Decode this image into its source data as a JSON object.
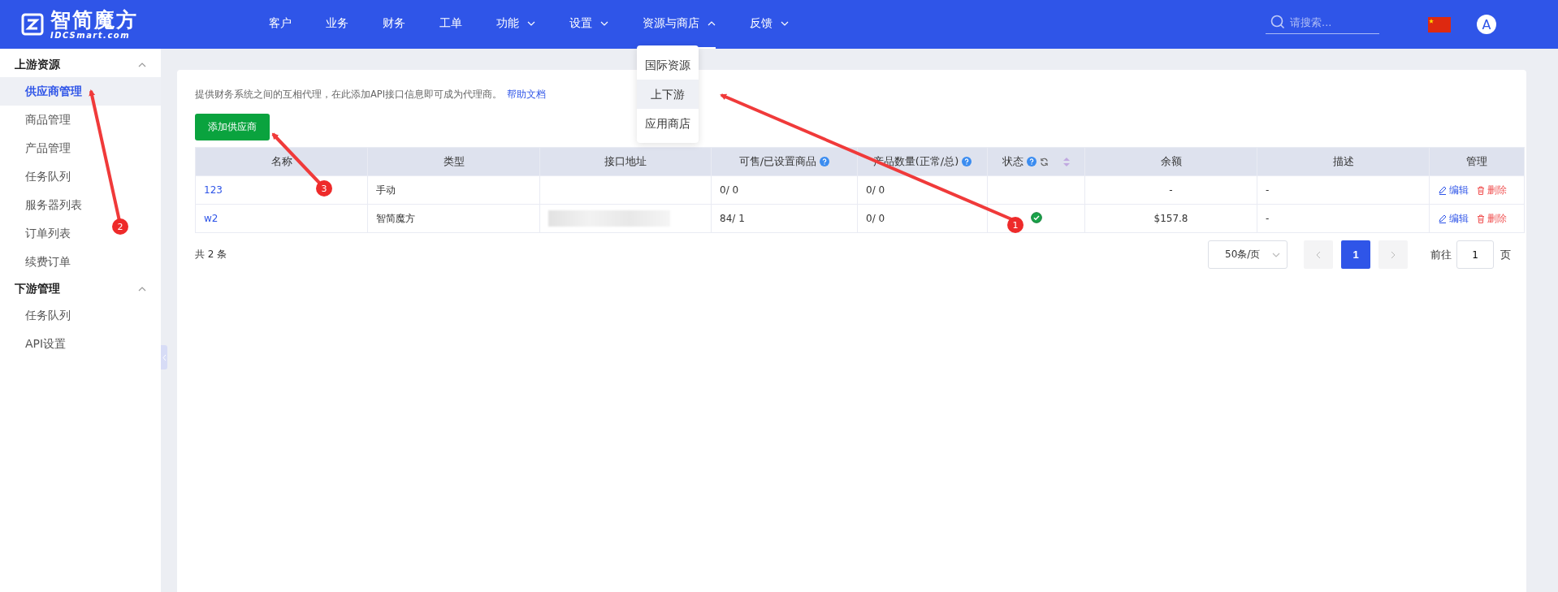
{
  "logo": {
    "name": "智简魔方",
    "domain": "IDCSmart.com"
  },
  "nav": [
    {
      "label": "客户",
      "selected": false
    },
    {
      "label": "业务",
      "selected": false
    },
    {
      "label": "财务",
      "selected": false
    },
    {
      "label": "工单",
      "selected": false
    },
    {
      "label": "功能",
      "selected": false,
      "expanded": false
    },
    {
      "label": "设置",
      "selected": false,
      "expanded": false
    },
    {
      "label": "资源与商店",
      "selected": true,
      "expanded": true,
      "menu": [
        {
          "label": "国际资源",
          "selected": false
        },
        {
          "label": "上下游",
          "selected": true
        },
        {
          "label": "应用商店",
          "selected": false
        }
      ]
    },
    {
      "label": "反馈",
      "selected": false,
      "expanded": false
    }
  ],
  "search": {
    "placeholder": "请搜索..."
  },
  "avatar": "A",
  "sidebar": [
    {
      "title": "上游资源",
      "expanded": true,
      "items": [
        {
          "label": "供应商管理",
          "selected": true
        },
        {
          "label": "商品管理",
          "selected": false
        },
        {
          "label": "产品管理",
          "selected": false
        },
        {
          "label": "任务队列",
          "selected": false
        },
        {
          "label": "服务器列表",
          "selected": false
        },
        {
          "label": "订单列表",
          "selected": false
        },
        {
          "label": "续费订单",
          "selected": false
        }
      ]
    },
    {
      "title": "下游管理",
      "expanded": true,
      "items": [
        {
          "label": "任务队列",
          "selected": false
        },
        {
          "label": "API设置",
          "selected": false
        }
      ]
    }
  ],
  "notice": {
    "text": "提供财务系统之间的互相代理，在此添加API接口信息即可成为代理商。",
    "link": "帮助文档"
  },
  "add_button": "添加供应商",
  "table": {
    "columns": [
      {
        "label": "名称",
        "kind": "plain"
      },
      {
        "label": "类型",
        "kind": "plain"
      },
      {
        "label": "接口地址",
        "kind": "plain"
      },
      {
        "label": "可售/已设置商品",
        "kind": "help"
      },
      {
        "label": "产品数量(正常/总)",
        "kind": "help"
      },
      {
        "label": "状态",
        "kind": "status"
      },
      {
        "label": "余额",
        "kind": "plain"
      },
      {
        "label": "描述",
        "kind": "plain"
      },
      {
        "label": "管理",
        "kind": "plain"
      }
    ],
    "rows": [
      {
        "name": "123",
        "type": "手动",
        "address_blurred": false,
        "goods": "0/ 0",
        "products": "0/ 0",
        "status_ok": false,
        "balance": "-",
        "description": "-",
        "actions": [
          {
            "kind": "edit",
            "label": "编辑"
          },
          {
            "kind": "delete",
            "label": "删除"
          }
        ]
      },
      {
        "name": "w2",
        "type": "智简魔方",
        "address_blurred": true,
        "goods": "84/ 1",
        "products": "0/ 0",
        "status_ok": true,
        "balance": "$157.8",
        "description": "-",
        "actions": [
          {
            "kind": "edit",
            "label": "编辑"
          },
          {
            "kind": "delete",
            "label": "删除"
          }
        ]
      }
    ]
  },
  "total": "共 2 条",
  "pagination": {
    "page_size": "50条/页",
    "pages": [
      {
        "label": "1",
        "selected": true
      }
    ],
    "goto_label": "前往",
    "goto_value": "1",
    "goto_unit": "页"
  },
  "annotations": [
    {
      "label": "1"
    },
    {
      "label": "2"
    },
    {
      "label": "3"
    }
  ]
}
